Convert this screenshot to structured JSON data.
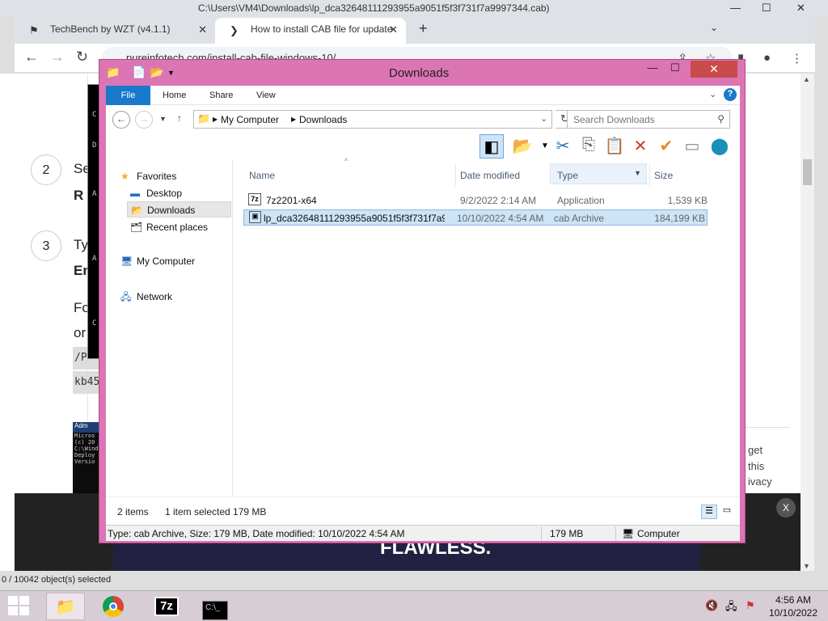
{
  "browser": {
    "title": "C:\\Users\\VM4\\Downloads\\lp_dca32648111293955a9051f5f3f731f7a9997344.cab)",
    "tabs": [
      {
        "label": "TechBench by WZT (v4.1.1)"
      },
      {
        "label": "How to install CAB file for update"
      }
    ],
    "url": "pureinfotech.com/install-cab-file-windows-10/"
  },
  "article": {
    "step2_num": "2",
    "step2_line1": "Se",
    "step2_line2": "R",
    "step3_num": "3",
    "step3_line1": "Ty",
    "step3_line2": "En",
    "para_line1": "Fo",
    "para_line2": "or",
    "code_line1": "/P",
    "code_line2": "kb45",
    "thumb_title": "Adm",
    "thumb_lines": [
      "Micros",
      "(c) 20",
      "",
      "C:\\Wind",
      "",
      "Deploy",
      "Versio"
    ],
    "card_lines": [
      "get",
      "this",
      "ivacy"
    ]
  },
  "ad": {
    "text": "FLAWLESS.",
    "close": "X"
  },
  "bg_status": "0 / 10042 object(s) selected",
  "explorer": {
    "title": "Downloads",
    "ribbon_tabs": [
      "File",
      "Home",
      "Share",
      "View"
    ],
    "breadcrumb": [
      "My Computer",
      "Downloads"
    ],
    "search_placeholder": "Search Downloads",
    "nav": {
      "favorites": "Favorites",
      "desktop": "Desktop",
      "downloads": "Downloads",
      "recent": "Recent places",
      "computer": "My Computer",
      "network": "Network"
    },
    "columns": [
      "Name",
      "Date modified",
      "Type",
      "Size"
    ],
    "files": [
      {
        "name": "7z2201-x64",
        "date": "9/2/2022 2:14 AM",
        "type": "Application",
        "size": "1,539 KB",
        "icon": "7zip-app-icon"
      },
      {
        "name": "lp_dca32648111293955a9051f5f3f731f7a9...",
        "date": "10/10/2022 4:54 AM",
        "type": "cab Archive",
        "size": "184,199 KB",
        "icon": "cab-archive-icon"
      }
    ],
    "status": {
      "items": "2 items",
      "selected": "1 item selected  179 MB"
    },
    "details": {
      "info": "Type: cab Archive, Size: 179 MB, Date modified: 10/10/2022 4:54 AM",
      "size": "179 MB",
      "location": "Computer"
    }
  },
  "taskbar": {
    "time": "4:56 AM",
    "date": "10/10/2022",
    "apps": [
      "file-explorer-icon",
      "chrome-icon",
      "7zip-icon",
      "cmd-icon"
    ]
  }
}
